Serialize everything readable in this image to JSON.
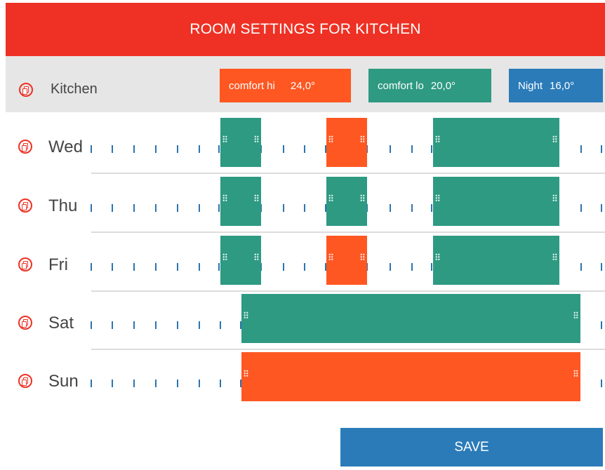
{
  "header": {
    "title": "ROOM SETTINGS FOR KITCHEN"
  },
  "room": {
    "name": "Kitchen"
  },
  "presets": [
    {
      "label": "comfort hi",
      "temp": "24,0°",
      "color": "#ff5722"
    },
    {
      "label": "comfort lo",
      "temp": "20,0°",
      "color": "#2e9a82"
    },
    {
      "label": "Night",
      "temp": "16,0°",
      "color": "#2b7bb9"
    }
  ],
  "schedule": [
    {
      "day": "Wed",
      "blocks": [
        {
          "mode": "comfort lo"
        },
        {
          "mode": "comfort hi"
        },
        {
          "mode": "comfort lo"
        }
      ]
    },
    {
      "day": "Thu",
      "blocks": [
        {
          "mode": "comfort lo"
        },
        {
          "mode": "comfort lo"
        },
        {
          "mode": "comfort lo"
        }
      ]
    },
    {
      "day": "Fri",
      "blocks": [
        {
          "mode": "comfort lo"
        },
        {
          "mode": "comfort hi"
        },
        {
          "mode": "comfort lo"
        }
      ]
    },
    {
      "day": "Sat",
      "blocks": [
        {
          "mode": "comfort lo"
        }
      ]
    },
    {
      "day": "Sun",
      "blocks": [
        {
          "mode": "comfort hi"
        }
      ]
    }
  ],
  "actions": {
    "save_label": "SAVE"
  },
  "colors": {
    "accent": "#ee3124",
    "comfort_hi": "#ff5722",
    "comfort_lo": "#2e9a82",
    "night": "#2b7bb9"
  }
}
